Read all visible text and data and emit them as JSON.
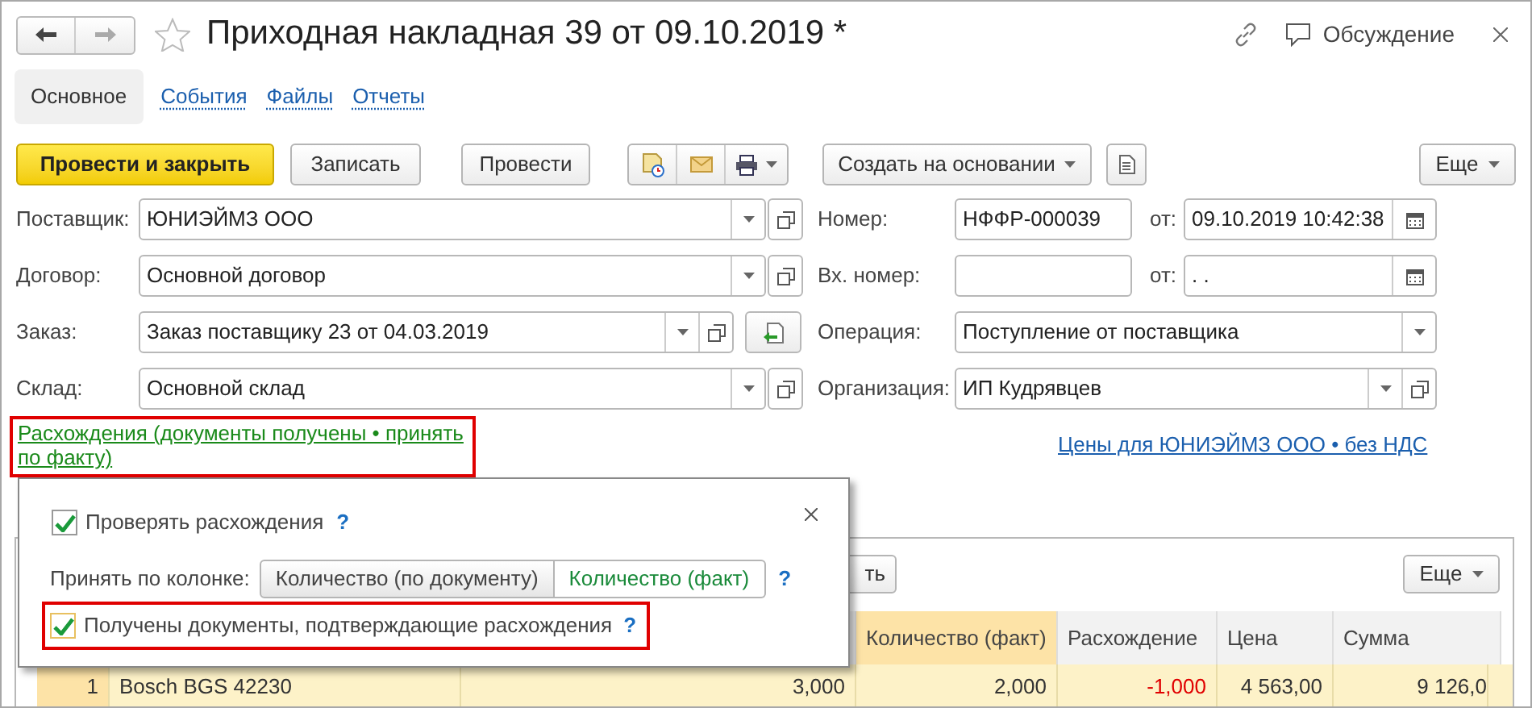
{
  "window": {
    "title": "Приходная накладная 39 от 09.10.2019 *",
    "discussion": "Обсуждение"
  },
  "tabs": [
    {
      "label": "Основное",
      "selected": true
    },
    {
      "label": "События",
      "selected": false
    },
    {
      "label": "Файлы",
      "selected": false
    },
    {
      "label": "Отчеты",
      "selected": false
    }
  ],
  "toolbar": {
    "buttons": [
      {
        "kind": "primary",
        "label": "Провести и закрыть"
      },
      {
        "kind": "plain",
        "label": "Записать"
      },
      {
        "kind": "plain",
        "label": "Провести"
      }
    ],
    "create_based_on": "Создать на основании",
    "more": "Еще"
  },
  "left_fields": [
    {
      "kind": "select_open",
      "label": "Поставщик:",
      "value": "ЮНИЭЙМЗ ООО"
    },
    {
      "kind": "select_open",
      "label": "Договор:",
      "value": "Основной договор"
    },
    {
      "kind": "order",
      "label": "Заказ:",
      "value": "Заказ поставщику 23 от 04.03.2019"
    },
    {
      "kind": "select_open",
      "label": "Склад:",
      "value": "Основной склад"
    }
  ],
  "right_fields": [
    {
      "kind": "number_date",
      "label": "Номер:",
      "value": "НФФР-000039",
      "date_label": "от:",
      "date": "09.10.2019 10:42:38"
    },
    {
      "kind": "number_date",
      "label": "Вх. номер:",
      "date_label": "от:",
      "date": ".  ."
    },
    {
      "kind": "select",
      "label": "Операция:",
      "value": "Поступление от поставщика"
    },
    {
      "kind": "select_open_inner",
      "label": "Организация:",
      "value": "ИП Кудрявцев"
    }
  ],
  "discrepancy_link": "Расхождения (документы получены • принять по факту)",
  "prices_link": "Цены для ЮНИЭЙМЗ ООО • без НДС",
  "popup": {
    "check_discrepancies": {
      "label": "Проверять расхождения",
      "checked": true,
      "help": "?"
    },
    "accept_label": "Принять по колонке:",
    "accept_options": [
      {
        "label": "Количество (по документу)",
        "selected": false
      },
      {
        "label": "Количество (факт)",
        "selected": true
      }
    ],
    "accept_help": "?",
    "documents_received": {
      "label": "Получены документы, подтверждающие расхождения",
      "checked": true,
      "help": "?"
    }
  },
  "table": {
    "fill_button": "ть",
    "more_button": "Еще",
    "columns": [
      null,
      null,
      null,
      {
        "label": "Количество (факт)",
        "selected": true
      },
      {
        "label": "Расхождение",
        "selected": false
      },
      {
        "label": "Цена",
        "selected": false
      },
      {
        "label": "Сумма",
        "selected": false
      }
    ],
    "rows": [
      {
        "selected": true,
        "discrepancy_negative": true,
        "cells": [
          "1",
          "Bosch BGS 42230",
          "3,000",
          "2,000",
          "-1,000",
          "4 563,00",
          "9 126,0"
        ]
      }
    ]
  }
}
